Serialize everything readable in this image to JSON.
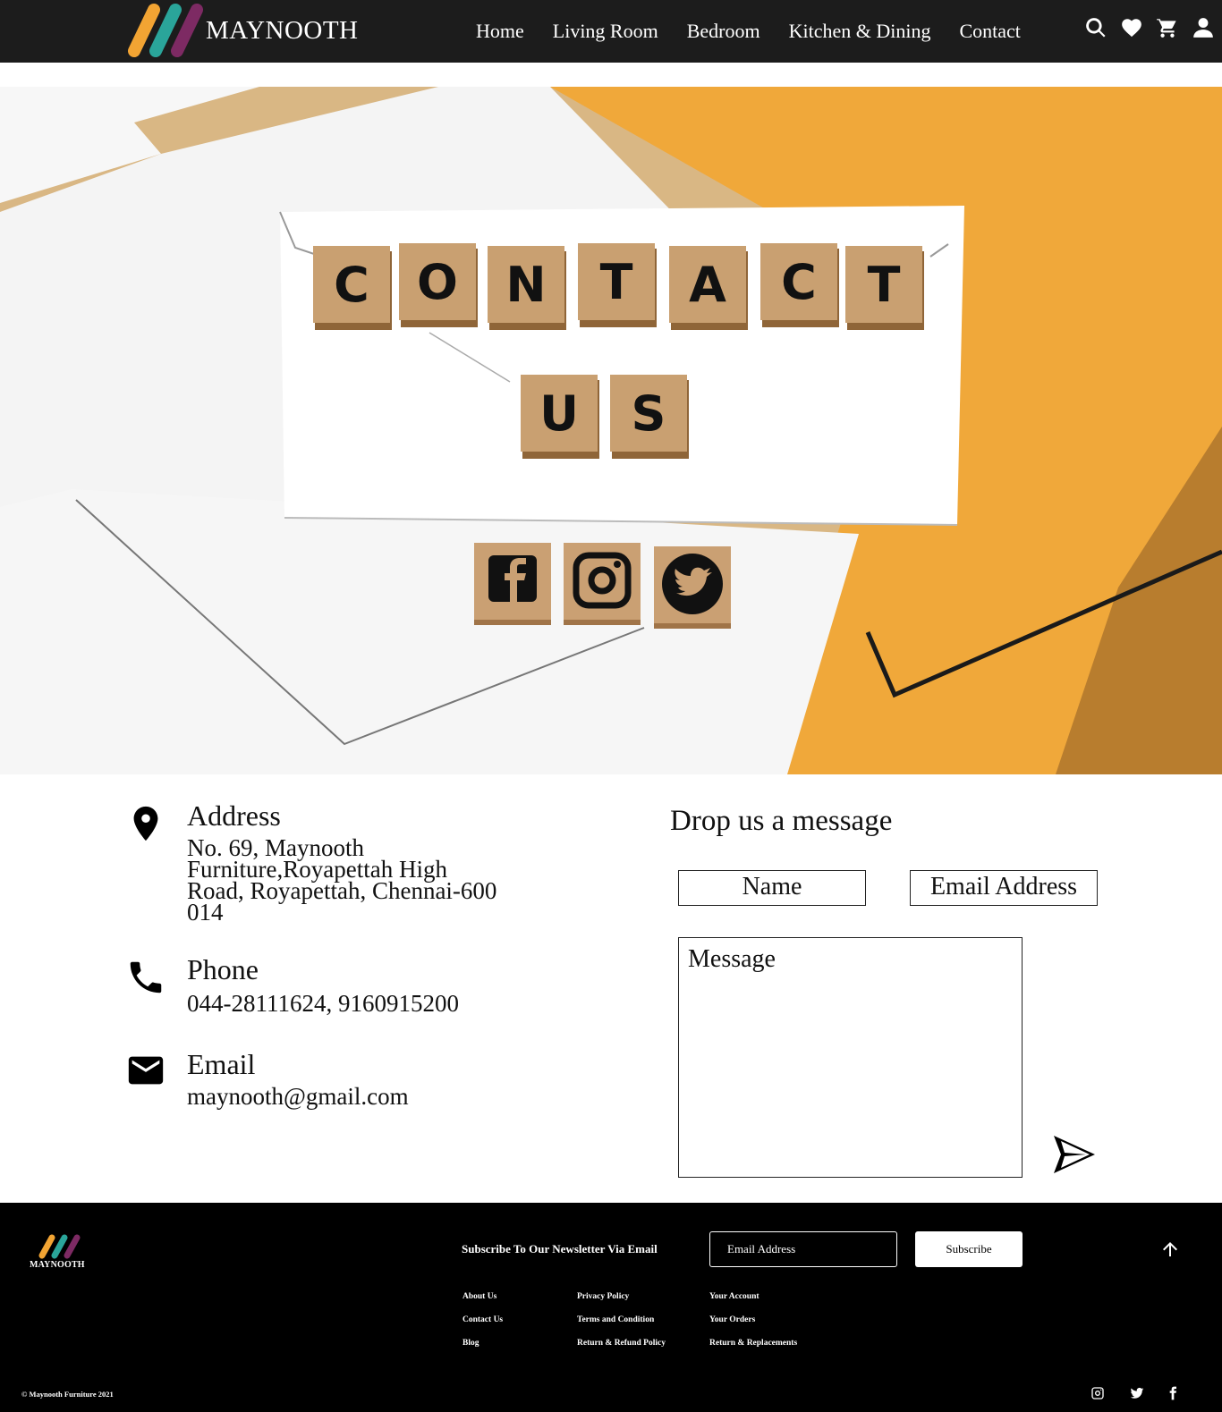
{
  "brand": {
    "name": "MAYNOOTH"
  },
  "nav": {
    "items": [
      "Home",
      "Living Room",
      "Bedroom",
      "Kitchen & Dining",
      "Contact"
    ],
    "icons": [
      "search-icon",
      "heart-icon",
      "cart-icon",
      "user-icon"
    ]
  },
  "hero": {
    "tiles_row1": [
      "C",
      "O",
      "N",
      "T",
      "A",
      "C",
      "T"
    ],
    "tiles_row2": [
      "U",
      "S"
    ],
    "social_tiles": [
      "facebook-icon",
      "instagram-icon",
      "twitter-icon"
    ]
  },
  "contact": {
    "address": {
      "title": "Address",
      "text": "No. 69, Maynooth Furniture,Royapettah High Road, Royapettah, Chennai-600 014",
      "icon": "location-pin-icon"
    },
    "phone": {
      "title": "Phone",
      "text": "044-28111624, 9160915200",
      "icon": "phone-icon"
    },
    "email": {
      "title": "Email",
      "text": "maynooth@gmail.com",
      "icon": "mail-icon"
    }
  },
  "form": {
    "title": "Drop us a message",
    "name_placeholder": "Name",
    "email_placeholder": "Email Address",
    "message_placeholder": "Message",
    "send_icon": "send-icon"
  },
  "footer": {
    "brand": "MAYNOOTH",
    "newsletter_label": "Subscribe To Our Newsletter Via Email",
    "newsletter_placeholder": "Email Address",
    "subscribe_label": "Subscribe",
    "columns": [
      [
        "About Us",
        "Contact Us",
        "Blog"
      ],
      [
        "Privacy Policy",
        "Terms and Condition",
        "Return & Refund Policy"
      ],
      [
        "Your Account",
        "Your Orders",
        "Return & Replacements"
      ]
    ],
    "copyright": "© Maynooth Furniture 2021",
    "social_icons": [
      "instagram-icon",
      "twitter-icon",
      "facebook-icon"
    ]
  },
  "colors": {
    "header_bg": "#1c1c1c",
    "footer_bg": "#000000",
    "logo_orange": "#f2a433",
    "logo_teal": "#2aa59a",
    "logo_purple": "#7d2a63",
    "hero_orange": "#f0a83a"
  }
}
